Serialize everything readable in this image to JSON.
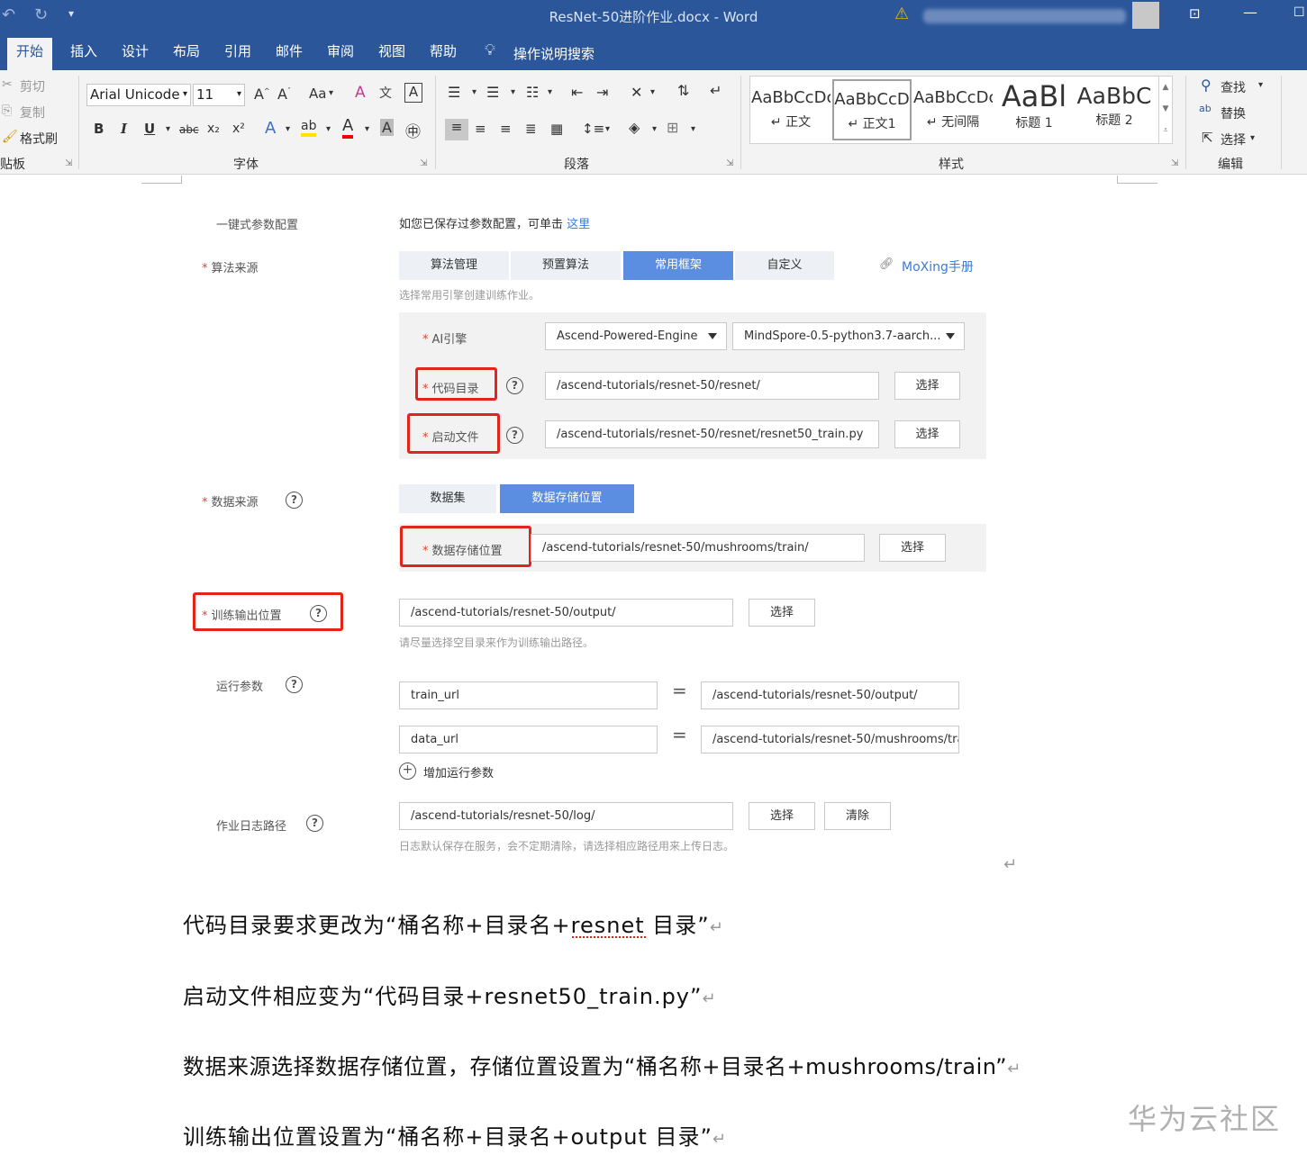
{
  "window": {
    "title": "ResNet-50进阶作业.docx  -  Word"
  },
  "ribbon_tabs": [
    "开始",
    "插入",
    "设计",
    "布局",
    "引用",
    "邮件",
    "审阅",
    "视图",
    "帮助"
  ],
  "tell_me": "操作说明搜索",
  "clipboard": {
    "cut": "剪切",
    "copy": "复制",
    "format_painter": "格式刷",
    "label": "贴板"
  },
  "font": {
    "name": "Arial Unicode",
    "size": "11",
    "case_label": "Aa",
    "label": "字体",
    "bold": "B",
    "italic": "I",
    "underline": "U",
    "strike": "abc",
    "sub": "x₂",
    "sup": "x²"
  },
  "paragraph": {
    "label": "段落"
  },
  "styles": {
    "label": "样式",
    "items": [
      {
        "preview": "AaBbCcDc",
        "name": "↵ 正文"
      },
      {
        "preview": "AaBbCcD",
        "name": "↵ 正文1"
      },
      {
        "preview": "AaBbCcDc",
        "name": "↵ 无间隔"
      },
      {
        "preview": "AaBl",
        "name": "标题 1"
      },
      {
        "preview": "AaBbC",
        "name": "标题 2"
      }
    ]
  },
  "editing": {
    "find": "查找",
    "replace": "替换",
    "select": "选择",
    "label": "编辑"
  },
  "form": {
    "oneclick_label": "一键式参数配置",
    "oneclick_text": "如您已保存过参数配置，可单击",
    "oneclick_link": "这里",
    "algo_source_label": "算法来源",
    "algo_tabs": [
      "算法管理",
      "预置算法",
      "常用框架",
      "自定义"
    ],
    "moxing_link": "MoXing手册",
    "algo_hint": "选择常用引擎创建训练作业。",
    "ai_engine_label": "AI引擎",
    "ai_engine_value": "Ascend-Powered-Engine",
    "ai_engine_version": "MindSpore-0.5-python3.7-aarch...",
    "code_dir_label": "代码目录",
    "code_dir_value": "/ascend-tutorials/resnet-50/resnet/",
    "boot_file_label": "启动文件",
    "boot_file_value": "/ascend-tutorials/resnet-50/resnet/resnet50_train.py",
    "choose": "选择",
    "clear": "清除",
    "data_source_label": "数据来源",
    "data_tabs": [
      "数据集",
      "数据存储位置"
    ],
    "data_storage_label": "数据存储位置",
    "data_storage_value": "/ascend-tutorials/resnet-50/mushrooms/train/",
    "train_output_label": "训练输出位置",
    "train_output_value": "/ascend-tutorials/resnet-50/output/",
    "train_output_hint": "请尽量选择空目录来作为训练输出路径。",
    "run_params_label": "运行参数",
    "params": [
      {
        "key": "train_url",
        "value": "/ascend-tutorials/resnet-50/output/"
      },
      {
        "key": "data_url",
        "value": "/ascend-tutorials/resnet-50/mushrooms/tra"
      }
    ],
    "eq": "=",
    "add_param": "增加运行参数",
    "log_path_label": "作业日志路径",
    "log_path_value": "/ascend-tutorials/resnet-50/log/",
    "log_hint": "日志默认保存在服务，会不定期清除，请选择相应路径用来上传日志。"
  },
  "paragraphs": [
    "代码目录要求更改为“桶名称+目录名+resnet 目录”",
    "启动文件相应变为“代码目录+resnet50_train.py”",
    "数据来源选择数据存储位置，存储位置设置为“桶名称+目录名+mushrooms/train”",
    "训练输出位置设置为“桶名称+目录名+output 目录”"
  ],
  "watermark": "华为云社区",
  "colors": {
    "word_blue": "#2b579a",
    "accent": "#5b8de0",
    "red": "#e1251b"
  }
}
